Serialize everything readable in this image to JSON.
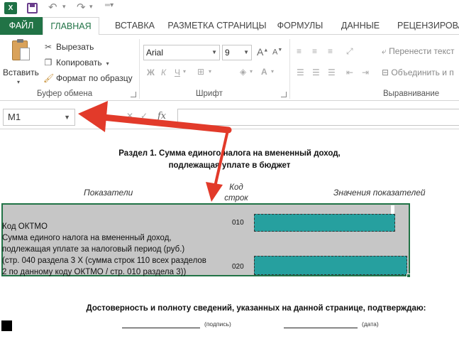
{
  "qat": {
    "app_icon": "X"
  },
  "tabs": [
    {
      "label": "ФАЙЛ"
    },
    {
      "label": "ГЛАВНАЯ"
    },
    {
      "label": "ВСТАВКА"
    },
    {
      "label": "РАЗМЕТКА СТРАНИЦЫ"
    },
    {
      "label": "ФОРМУЛЫ"
    },
    {
      "label": "ДАННЫЕ"
    },
    {
      "label": "РЕЦЕНЗИРОВА"
    }
  ],
  "ribbon": {
    "clipboard": {
      "paste_label": "Вставить",
      "cut": "Вырезать",
      "copy": "Копировать",
      "format_painter": "Формат по образцу",
      "group_label": "Буфер обмена"
    },
    "font": {
      "font_name": "Arial",
      "font_size": "9",
      "bold": "Ж",
      "italic": "К",
      "underline": "Ч",
      "color_letter": "А",
      "grow": "A",
      "shrink": "A",
      "group_label": "Шрифт"
    },
    "alignment": {
      "wrap_text": "Перенести текст",
      "merge_center": "Объединить и п",
      "group_label": "Выравнивание"
    }
  },
  "formula_bar": {
    "name_box": "M1",
    "fx": "fx",
    "formula": ""
  },
  "sheet": {
    "section_title_line1": "Раздел 1. Сумма единого налога на вмененный доход,",
    "section_title_line2": "подлежащая уплате в бюджет",
    "col_indicators": "Показатели",
    "col_code_line1": "Код",
    "col_code_line2": "строк",
    "col_values": "Значения показателей",
    "row1_label": "Код ОКТМО",
    "row1_code": "010",
    "row2_line1": " Сумма единого налога на вмененный доход,",
    "row2_line2": "подлежащая уплате за налоговый период (руб.)",
    "row2_line3": "(стр. 040 раздела 3 X (сумма строк 110 всех разделов",
    "row2_line4": "2 по данному коду ОКТМО / стр. 010 раздела 3))",
    "row2_code": "020",
    "confirm": "Достоверность и полноту сведений, указанных на данной странице, подтверждаю:",
    "sig_caption": "(подпись)",
    "date_caption": "(дата)"
  },
  "colors": {
    "excel_green": "#217346",
    "highlight_teal": "#26a09f",
    "annotation_red": "#e23a2a"
  }
}
